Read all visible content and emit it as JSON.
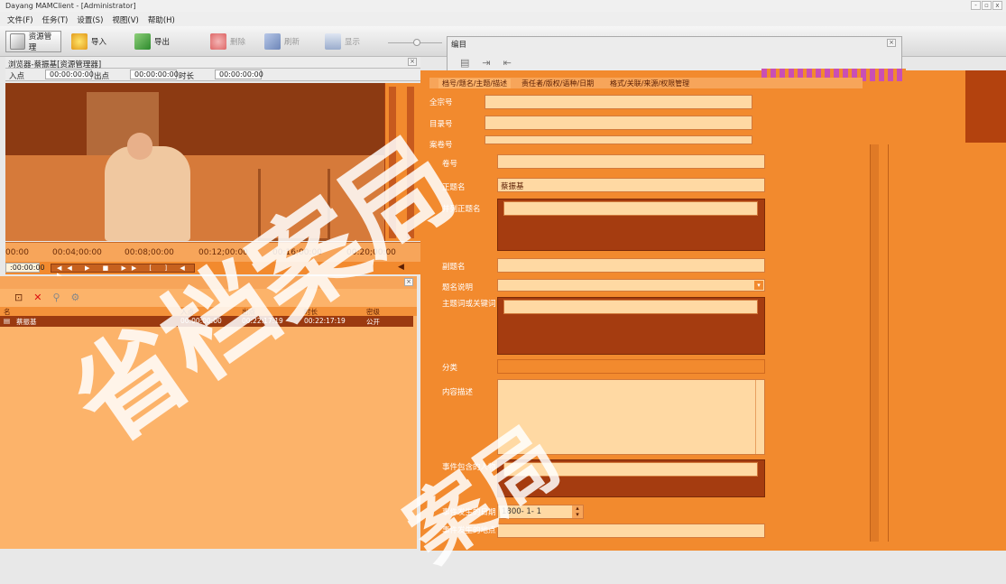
{
  "window": {
    "title": "Dayang MAMClient - [Administrator]",
    "min": "-",
    "restore": "▫",
    "close": "x"
  },
  "menu": [
    "文件(F)",
    "任务(T)",
    "设置(S)",
    "视图(V)",
    "帮助(H)"
  ],
  "toolbar": {
    "resource_mgmt": "资源管理",
    "import": "导入",
    "export": "导出",
    "delete": "删除",
    "refresh": "刷新",
    "display": "显示"
  },
  "browser": {
    "title": "浏览器-蔡振基[资源管理器]",
    "in_label": "入点",
    "in_value": "00:00:00:00",
    "out_label": "出点",
    "out_value": "00:00:00:00",
    "dur_label": "时长",
    "dur_value": "00:00:00:00",
    "ruler": [
      "00:00",
      "00:04;00:00",
      "00:08;00:00",
      "00:12;00:00",
      "00:16;00:00",
      "00:20;00:00"
    ],
    "current_tc": ":00:00:00"
  },
  "clips": {
    "headers": [
      "名",
      "入点",
      "出点",
      "时长",
      "密级"
    ],
    "rows": [
      {
        "name": "蔡振基",
        "in": "00:00:00:00",
        "out": "00:22:17:19",
        "dur": "00:22:17:19",
        "level": "公开"
      }
    ]
  },
  "catalog": {
    "title": "编目",
    "tabs": [
      "档号/题名/主题/描述",
      "责任者/版权/语种/日期",
      "格式/关联/来源/权限管理"
    ],
    "fields": {
      "quanzong": "全宗号",
      "mulu": "目录号",
      "anjuan": "案卷号",
      "juan": "卷号",
      "zhengtiming": "正题名",
      "zhengtiming_value": "蔡振基",
      "bingliezheng": "并列正题名",
      "futiming": "副题名",
      "timingshuoming": "题名说明",
      "zhutici": "主题词或关键词",
      "fenlei": "分类",
      "neirong": "内容描述",
      "renwu": "事件包含的人物",
      "riqi": "事件发生的日期",
      "riqi_value": "1800- 1- 1",
      "didian": "事件发生的地点"
    }
  },
  "watermark": {
    "text1": "省档案局",
    "text2": "案局"
  },
  "colors": {
    "orange": "#fcb36a",
    "deep": "#f28a2e",
    "dark": "#a53c10",
    "field": "#ffd9a3"
  }
}
